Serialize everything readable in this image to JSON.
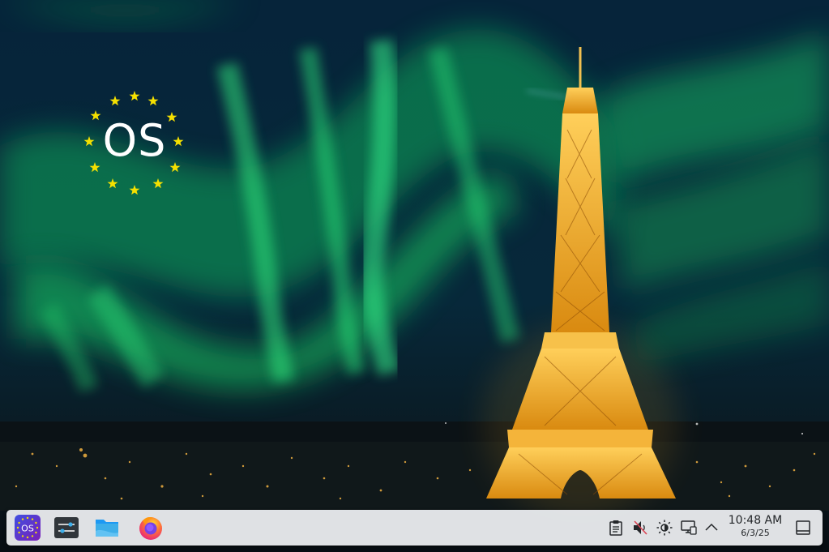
{
  "desktop": {
    "logo_text": "OS"
  },
  "taskbar": {
    "launchers": [
      {
        "icon": "os-launcher-icon",
        "label": "OS"
      },
      {
        "icon": "system-settings-icon"
      },
      {
        "icon": "file-manager-icon"
      },
      {
        "icon": "firefox-icon"
      }
    ],
    "tray": [
      {
        "icon": "clipboard-icon"
      },
      {
        "icon": "volume-muted-icon"
      },
      {
        "icon": "brightness-icon"
      },
      {
        "icon": "network-icon"
      },
      {
        "icon": "chevron-up-icon"
      }
    ],
    "clock": {
      "time": "10:48 AM",
      "date": "6/3/25"
    },
    "show_desktop_icon": "show-desktop-icon"
  },
  "colors": {
    "aurora": "#1ed06a",
    "tower": "#f0a820",
    "star": "#f5e000",
    "taskbar_bg": "#e8eaed",
    "launcher_purple": "#5b2bc4"
  }
}
